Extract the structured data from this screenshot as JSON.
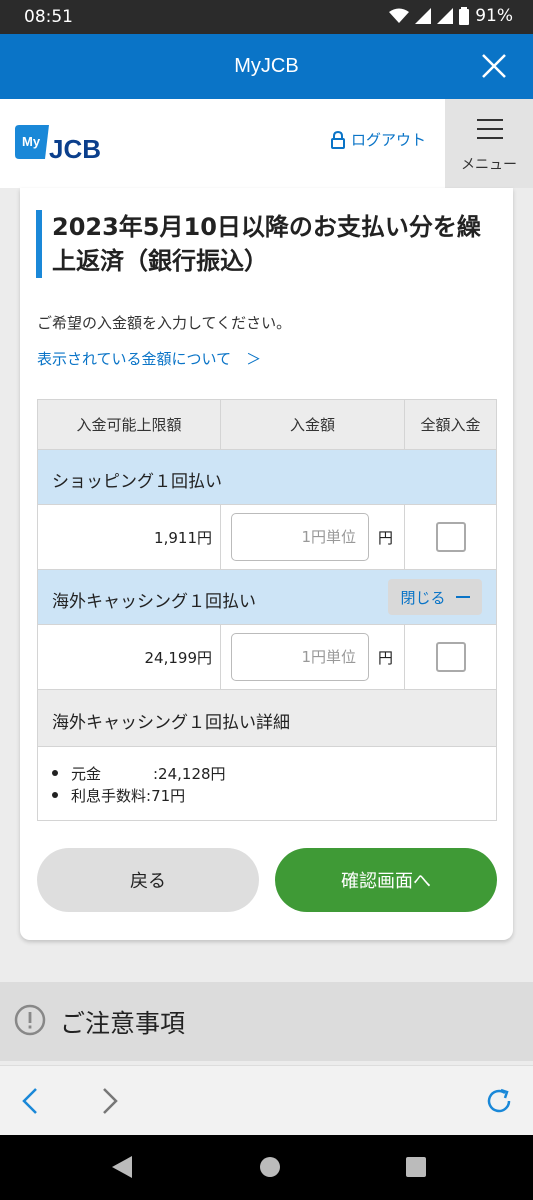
{
  "status_bar": {
    "time": "08:51",
    "battery": "91%"
  },
  "app_bar": {
    "title": "MyJCB"
  },
  "header": {
    "logo_text_my": "My",
    "logo_text_jcb": "JCB",
    "logout_label": "ログアウト",
    "menu_label": "メニュー"
  },
  "content": {
    "heading": "2023年5月10日以降のお支払い分を繰上返済（銀行振込）",
    "intro": "ご希望の入金額を入力してください。",
    "amount_link": "表示されている金額について　＞",
    "table": {
      "headers": [
        "入金可能上限額",
        "入金額",
        "全額入金"
      ],
      "sections": [
        {
          "label": "ショッピング１回払い",
          "limit": "1,911円",
          "placeholder": "1円単位",
          "unit": "円"
        },
        {
          "label": "海外キャッシング１回払い",
          "toggle": "閉じる",
          "limit": "24,199円",
          "placeholder": "1円単位",
          "unit": "円"
        }
      ],
      "detail": {
        "title": "海外キャッシング１回払い詳細",
        "items": [
          {
            "key": "元金",
            "value": ":24,128円"
          },
          {
            "key": "利息手数料",
            "value": ":71円"
          }
        ]
      }
    },
    "back_button": "戻る",
    "next_button": "確認画面へ"
  },
  "notice": {
    "title": "ご注意事項"
  },
  "colors": {
    "brand_blue": "#0a74c7",
    "confirm_green": "#3f9a36",
    "section_blue": "#cde4f6"
  }
}
